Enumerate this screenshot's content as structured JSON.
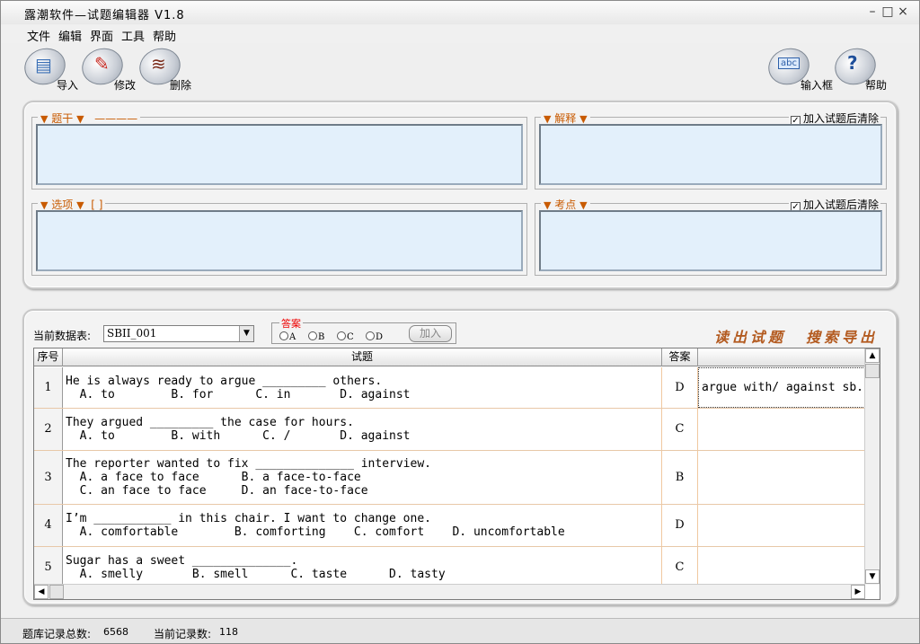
{
  "window": {
    "title": "露潮软件—试题编辑器 V1.8",
    "minimize": "–",
    "maximize": "□",
    "close": "×"
  },
  "menu": [
    "文件",
    "编辑",
    "界面",
    "工具",
    "帮助"
  ],
  "toolbar": {
    "left": [
      {
        "label": "导入",
        "icon": "import-notebook-icon"
      },
      {
        "label": "修改",
        "icon": "edit-pencil-icon"
      },
      {
        "label": "删除",
        "icon": "delete-scribble-icon"
      }
    ],
    "right": [
      {
        "label": "输入框",
        "icon": "abc-input-icon"
      },
      {
        "label": "帮助",
        "icon": "question-mark-icon"
      }
    ]
  },
  "editor": {
    "stem_legend": "题干",
    "stem_dashes": "————",
    "options_legend": "选项",
    "options_brackets": "[ ]",
    "explain_legend": "解释",
    "keypoint_legend": "考点",
    "clear_after_add": "加入试题后清除",
    "arrow": "▼"
  },
  "controls": {
    "db_label": "当前数据表:",
    "db_value": "SBII_001",
    "answer_legend": "答案",
    "options": [
      "A",
      "B",
      "C",
      "D"
    ],
    "add_button": "加入",
    "read_questions": "读出试题",
    "search_export": "搜索导出"
  },
  "table": {
    "headers": [
      "序号",
      "试题",
      "答案",
      ""
    ],
    "rows": [
      {
        "no": "1",
        "question": "He is always ready to argue _________ others.\n  A. to        B. for      C. in       D. against",
        "answer": "D",
        "explain": "argue with/ against sb."
      },
      {
        "no": "2",
        "question": "They argued _________ the case for hours.\n  A. to        B. with      C. /       D. against",
        "answer": "C",
        "explain": ""
      },
      {
        "no": "3",
        "question": "The reporter wanted to fix ______________ interview.\n  A. a face to face      B. a face-to-face\n  C. an face to face     D. an face-to-face",
        "answer": "B",
        "explain": ""
      },
      {
        "no": "4",
        "question": "I’m ___________ in this chair. I want to change one.\n  A. comfortable        B. comforting    C. comfort    D. uncomfortable",
        "answer": "D",
        "explain": ""
      },
      {
        "no": "5",
        "question": "Sugar has a sweet ______________.\n  A. smelly       B. smell      C. taste      D. tasty",
        "answer": "C",
        "explain": ""
      }
    ]
  },
  "status": {
    "total_label": "题库记录总数:",
    "total": "6568",
    "current_label": "当前记录数:",
    "current": "118"
  }
}
